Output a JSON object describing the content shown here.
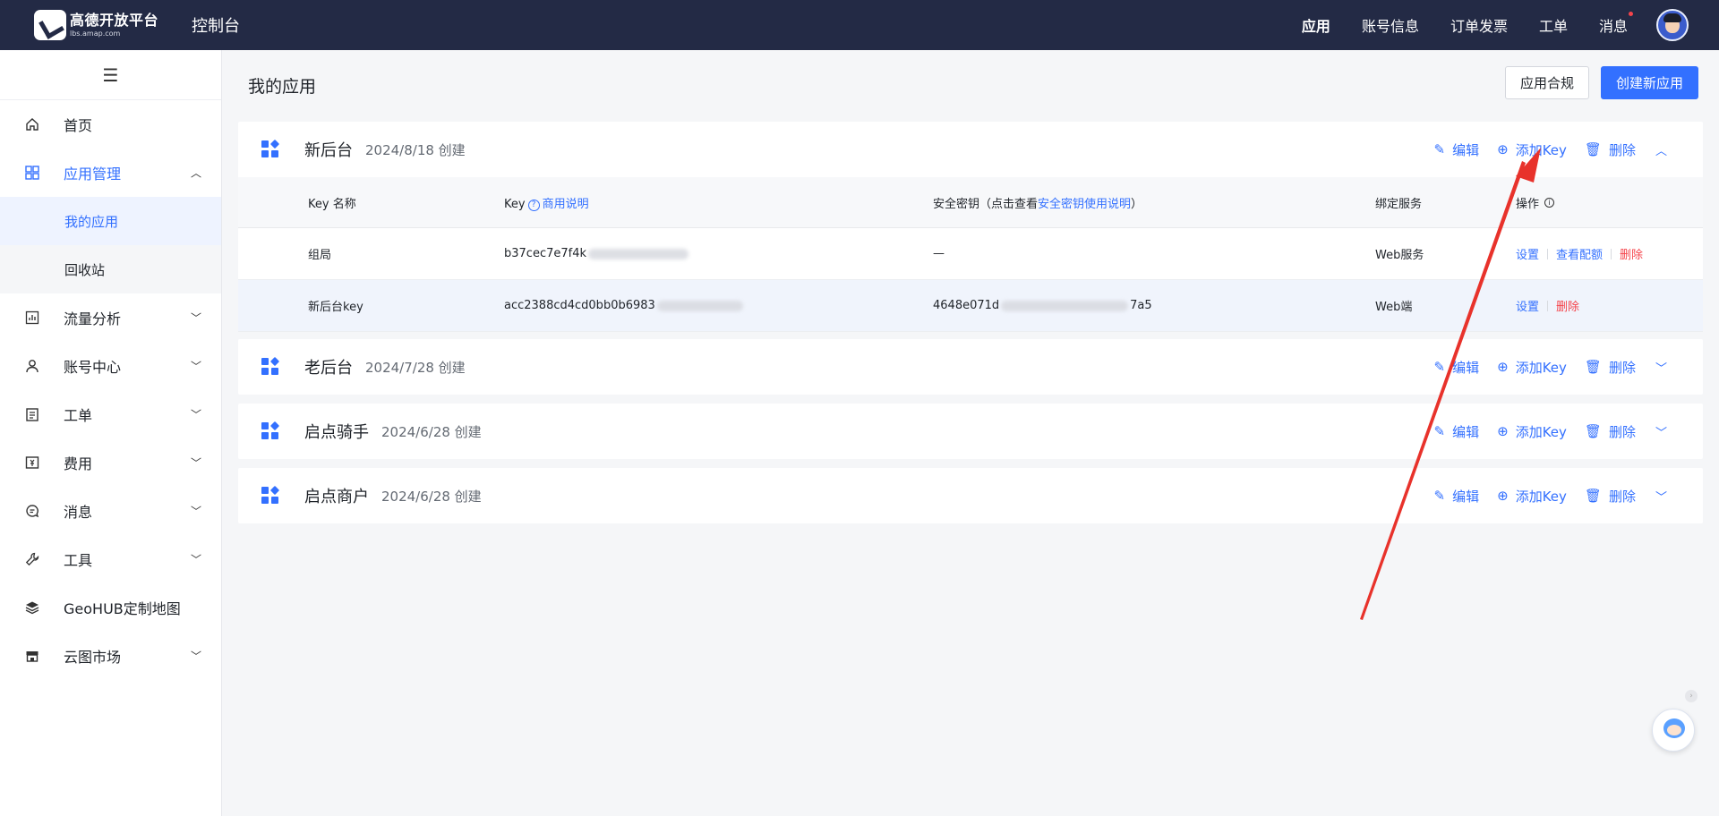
{
  "header": {
    "logo_name": "高德开放平台",
    "logo_url": "lbs.amap.com",
    "console_title": "控制台",
    "nav": [
      "应用",
      "账号信息",
      "订单发票",
      "工单",
      "消息"
    ]
  },
  "sidebar": {
    "toggle": "☰",
    "items": [
      {
        "label": "首页",
        "icon": "home-icon"
      },
      {
        "label": "应用管理",
        "icon": "grid-icon"
      },
      {
        "label": "流量分析",
        "icon": "chart-icon"
      },
      {
        "label": "账号中心",
        "icon": "user-icon"
      },
      {
        "label": "工单",
        "icon": "ticket-icon"
      },
      {
        "label": "费用",
        "icon": "fee-icon"
      },
      {
        "label": "消息",
        "icon": "message-icon"
      },
      {
        "label": "工具",
        "icon": "wrench-icon"
      },
      {
        "label": "GeoHUB定制地图",
        "icon": "layers-icon"
      },
      {
        "label": "云图市场",
        "icon": "store-icon"
      }
    ],
    "sub_items": [
      "我的应用",
      "回收站"
    ]
  },
  "main": {
    "title": "我的应用",
    "btn_compliance": "应用合规",
    "btn_create": "创建新应用"
  },
  "actions": {
    "edit": "编辑",
    "add_key": "添加Key",
    "delete": "删除"
  },
  "apps": [
    {
      "name": "新后台",
      "date": "2024/8/18 创建"
    },
    {
      "name": "老后台",
      "date": "2024/7/28 创建"
    },
    {
      "name": "启点骑手",
      "date": "2024/6/28 创建"
    },
    {
      "name": "启点商户",
      "date": "2024/6/28 创建"
    }
  ],
  "table": {
    "headers": {
      "key_name": "Key 名称",
      "key": "Key",
      "key_help": "商用说明",
      "secret_prefix": "安全密钥（点击查看",
      "secret_link": "安全密钥使用说明",
      "secret_suffix": "）",
      "service": "绑定服务",
      "ops": "操作"
    },
    "rows": [
      {
        "name": "组局",
        "key": "b37cec7e7f4k",
        "key_tail": "",
        "secret": "—",
        "secret_tail": "",
        "service": "Web服务",
        "ops": [
          "设置",
          "查看配额",
          "删除"
        ]
      },
      {
        "name": "新后台key",
        "key": "acc2388cd4cd0bb0b6983",
        "key_tail": "",
        "secret": "4648e071d",
        "secret_tail": "7a5",
        "service": "Web端",
        "ops": [
          "设置",
          "删除"
        ]
      }
    ]
  },
  "colors": {
    "topbar": "#232a45",
    "accent": "#3370ff",
    "danger": "#f5444b",
    "annotation": "#e8322b"
  }
}
